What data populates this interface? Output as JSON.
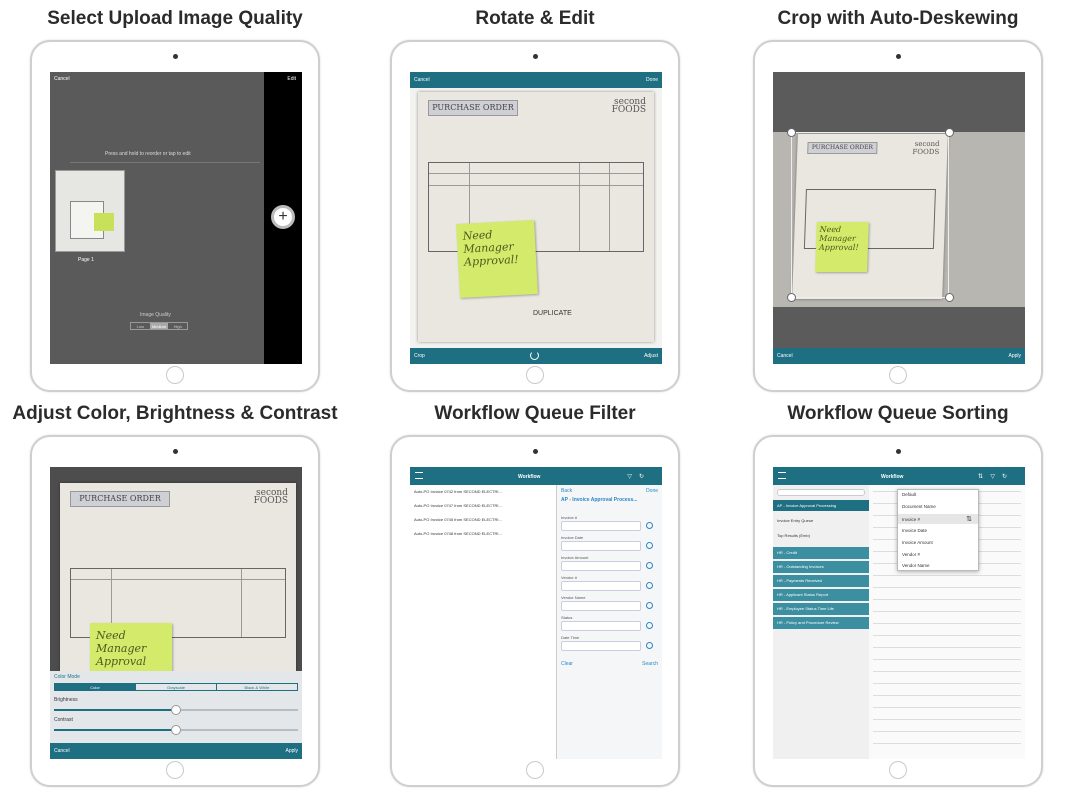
{
  "panels": [
    {
      "title": "Select Upload Image Quality",
      "screen": {
        "cancel": "Cancel",
        "edit": "Edit",
        "hint": "Press and hold to reorder or tap to edit",
        "page_label": "Page 1",
        "quality_label": "Image Quality",
        "quality_options": [
          "Low",
          "Medium",
          "High"
        ]
      }
    },
    {
      "title": "Rotate & Edit",
      "screen": {
        "cancel": "Cancel",
        "done": "Done",
        "crop": "Crop",
        "adjust": "Adjust",
        "doc_header": "PURCHASE ORDER",
        "logo": "second FOODS",
        "note": "Need Manager Approval!",
        "stamp": "DUPLICATE"
      }
    },
    {
      "title": "Crop with Auto-Deskewing",
      "screen": {
        "cancel": "Cancel",
        "apply": "Apply",
        "doc_header": "PURCHASE ORDER",
        "logo": "second FOODS",
        "note": "Need Manager Approval!"
      }
    },
    {
      "title": "Adjust Color, Brightness & Contrast",
      "screen": {
        "doc_header": "PURCHASE ORDER",
        "logo": "second FOODS",
        "note": "Need Manager Approval",
        "color_mode": "Color Mode",
        "modes": [
          "Color",
          "Grayscale",
          "Black & White"
        ],
        "brightness": "Brightness",
        "contrast": "Contrast",
        "brightness_value": 0.5,
        "contrast_value": 0.5,
        "cancel": "Cancel",
        "apply": "Apply"
      }
    },
    {
      "title": "Workflow Queue Filter",
      "screen": {
        "nav_title": "Workflow",
        "back": "Back",
        "done": "Done",
        "filter_title": "AP - Invoice Approval Process...",
        "items": [
          "Auto-PO Invoice 0742 from SECOND ELECTRI...",
          "Auto-PO Invoice 0747 from SECOND ELECTRI...",
          "Auto-PO Invoice 0745 from SECOND ELECTRI...",
          "Auto-PO Invoice 0748 from SECOND ELECTRI..."
        ],
        "fields": [
          "Invoice #",
          "Invoice Date",
          "Invoice Amount",
          "Vendor #",
          "Vendor Name",
          "Status",
          "Date Time"
        ],
        "clear": "Clear",
        "search": "Search"
      }
    },
    {
      "title": "Workflow Queue Sorting",
      "screen": {
        "nav_title": "Workflow",
        "sidebar": [
          "AP - Invoice Approval Processing",
          "Invoice Entry Queue",
          "Top Results (Emb)",
          "HR - Credit",
          "HR - Outstanding Invoices",
          "HR - Payments Received",
          "HR - Applicant Status Report",
          "HR - Employee Status Time Life",
          "HR - Policy and Procedure Review"
        ],
        "sort_options": [
          "Default",
          "Document Name",
          "Invoice #",
          "Invoice Date",
          "Invoice Amount",
          "Vendor #",
          "Vendor Name"
        ]
      }
    }
  ]
}
